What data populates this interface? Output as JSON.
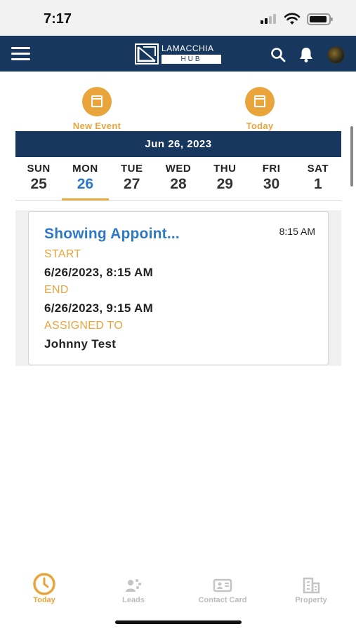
{
  "status_bar": {
    "time": "7:17"
  },
  "header": {
    "logo_top": "LAMACCHIA",
    "logo_bottom": "HUB"
  },
  "actions": {
    "new_event_label": "New Event",
    "today_label": "Today"
  },
  "calendar": {
    "current_date": "Jun 26, 2023",
    "days": [
      {
        "name": "SUN",
        "num": "25"
      },
      {
        "name": "MON",
        "num": "26"
      },
      {
        "name": "TUE",
        "num": "27"
      },
      {
        "name": "WED",
        "num": "28"
      },
      {
        "name": "THU",
        "num": "29"
      },
      {
        "name": "FRI",
        "num": "30"
      },
      {
        "name": "SAT",
        "num": "1"
      }
    ],
    "selected_day": "MON"
  },
  "event": {
    "title": "Showing Appoint...",
    "time": "8:15 AM",
    "start_label": "START",
    "start_value": "6/26/2023, 8:15 AM",
    "end_label": "END",
    "end_value": "6/26/2023, 9:15 AM",
    "assigned_label": "ASSIGNED TO",
    "assigned_value": "Johnny Test"
  },
  "bottom_nav": {
    "items": [
      {
        "label": "Today",
        "icon": "clock-icon",
        "active": true
      },
      {
        "label": "Leads",
        "icon": "leads-icon",
        "active": false
      },
      {
        "label": "Contact Card",
        "icon": "contact-card-icon",
        "active": false
      },
      {
        "label": "Property",
        "icon": "building-icon",
        "active": false
      }
    ]
  },
  "colors": {
    "navy": "#17375e",
    "accent_orange": "#e9a43c",
    "link_blue": "#2e78c4",
    "inactive_gray": "#bdbdbd"
  }
}
